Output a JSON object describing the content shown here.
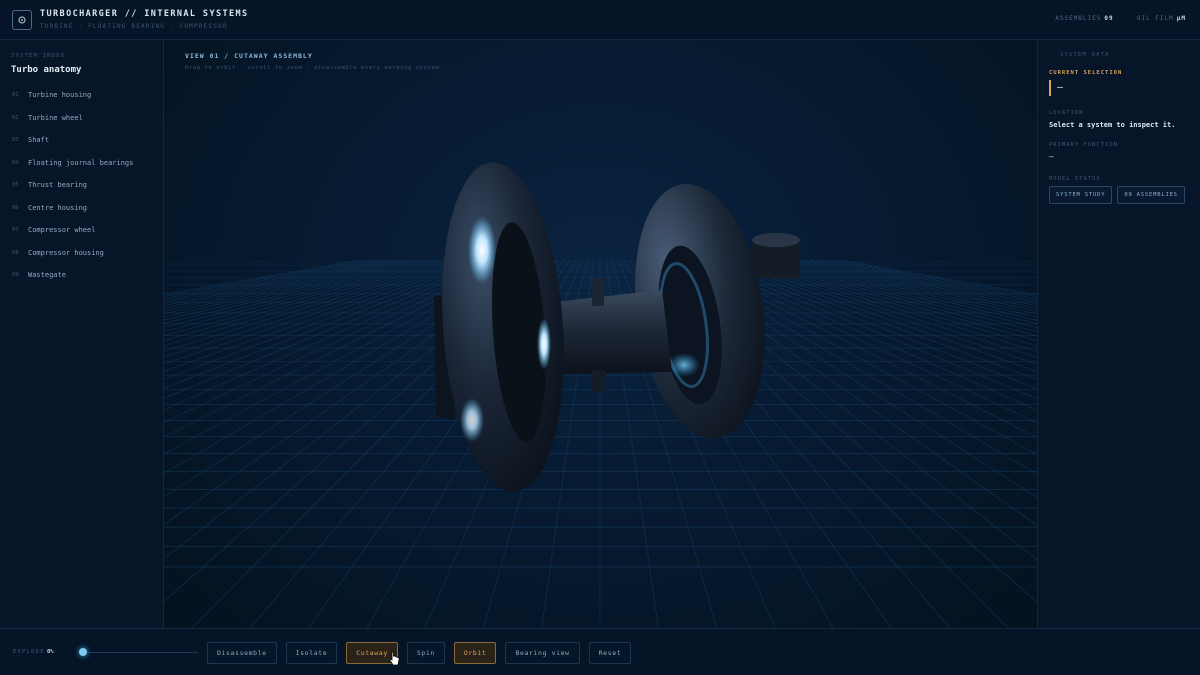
{
  "header": {
    "title": "TURBOCHARGER // INTERNAL SYSTEMS",
    "subtitle": "TURBINE · FLOATING BEARING · COMPRESSOR",
    "stats": [
      {
        "label": "ASSEMBLIES",
        "value": "09"
      },
      {
        "label": "OIL FILM",
        "value": "µM"
      }
    ]
  },
  "sidebar": {
    "kicker": "SYSTEM INDEX",
    "title": "Turbo anatomy",
    "items": [
      {
        "num": "01",
        "label": "Turbine housing"
      },
      {
        "num": "02",
        "label": "Turbine wheel"
      },
      {
        "num": "03",
        "label": "Shaft"
      },
      {
        "num": "04",
        "label": "Floating journal bearings"
      },
      {
        "num": "05",
        "label": "Thrust bearing"
      },
      {
        "num": "06",
        "label": "Centre housing"
      },
      {
        "num": "07",
        "label": "Compressor wheel"
      },
      {
        "num": "08",
        "label": "Compressor housing"
      },
      {
        "num": "09",
        "label": "Wastegate"
      }
    ]
  },
  "viewport": {
    "title": "VIEW 01 / CUTAWAY ASSEMBLY",
    "hint": "Drag to orbit · scroll to zoom · disassemble every working system"
  },
  "panel": {
    "kicker": "SYSTEM DATA",
    "current_selection_label": "CURRENT SELECTION",
    "current_selection_value": "—",
    "location_label": "LOCATION",
    "location_value": "Select a system to inspect it.",
    "function_label": "PRIMARY FUNCTION",
    "function_value": "—",
    "status_label": "MODEL STATUS",
    "chips": [
      "SYSTEM STUDY",
      "09 ASSEMBLIES"
    ]
  },
  "toolbar": {
    "explode_label": "EXPLODE",
    "explode_value": "0%",
    "explode_fraction": 0.0,
    "buttons": [
      {
        "label": "Disassemble",
        "active": false
      },
      {
        "label": "Isolate",
        "active": false
      },
      {
        "label": "Cutaway",
        "active": true
      },
      {
        "label": "Spin",
        "active": false
      },
      {
        "label": "Orbit",
        "active": true
      },
      {
        "label": "Bearing view",
        "active": false
      },
      {
        "label": "Reset",
        "active": false
      }
    ]
  },
  "colors": {
    "accent": "#d9a55d",
    "glow": "#5bc6ff",
    "background": "#04111f"
  }
}
